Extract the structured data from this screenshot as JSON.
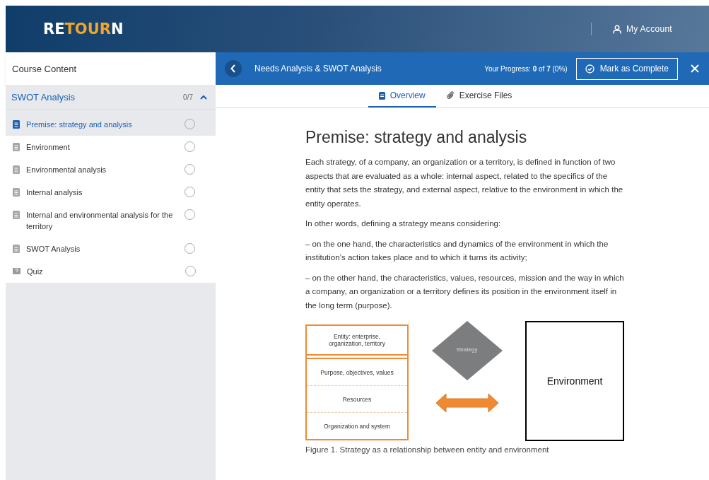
{
  "header": {
    "logo": [
      {
        "text": "RE",
        "accent": false
      },
      {
        "text": "TOUR",
        "accent": true
      },
      {
        "text": "N",
        "accent": false
      }
    ],
    "account": "My Account"
  },
  "sidebar": {
    "title": "Course Content",
    "section": {
      "title": "SWOT Analysis",
      "count": "0/7",
      "expanded": true
    },
    "items": [
      {
        "label": "Premise: strategy and analysis",
        "kind": "lesson",
        "selected": true,
        "completed": false
      },
      {
        "label": "Environment",
        "kind": "lesson",
        "selected": false,
        "completed": false
      },
      {
        "label": "Environmental analysis",
        "kind": "lesson",
        "selected": false,
        "completed": false
      },
      {
        "label": "Internal analysis",
        "kind": "lesson",
        "selected": false,
        "completed": false
      },
      {
        "label": "Internal and environmental analysis for the territory",
        "kind": "lesson",
        "selected": false,
        "completed": false
      },
      {
        "label": "SWOT Analysis",
        "kind": "lesson",
        "selected": false,
        "completed": false
      },
      {
        "label": "Quiz",
        "kind": "quiz",
        "selected": false,
        "completed": false
      }
    ]
  },
  "topbar": {
    "title": "Needs Analysis & SWOT Analysis",
    "progress": "Your Progress: **0** of **7** (0%)",
    "complete_button": "Mark as Complete"
  },
  "tabs": [
    {
      "label": "Overview",
      "kind": "doc",
      "selected": true
    },
    {
      "label": "Exercise Files",
      "kind": "clip",
      "selected": false
    }
  ],
  "article": {
    "title": "Premise: strategy and analysis",
    "paragraphs": [
      "Each strategy, of a company, an organization or a territory, is defined in function of two aspects that are evaluated as a whole: internal aspect, related to the specifics of the entity that sets the strategy, and external aspect, relative to the environment in which the entity operates.",
      "In other words, defining a strategy means considering:",
      "–  on the one hand, the characteristics and dynamics of the environment in which the institution’s action takes place and to which it turns its activity;",
      "– on the other hand, the characteristics, values, resources, mission and the way in which a company, an organization or a territory defines its position in the environment itself in the long term (purpose)."
    ],
    "figure": {
      "entity": "Entity: enterprise, organization, territory",
      "layers": [
        "Purpose, objectives, values",
        "Resources",
        "Organization and system"
      ],
      "strategy": "Strategy",
      "environment": "Environment",
      "caption": "Figure 1. Strategy as a relationship between entity and environment"
    }
  }
}
